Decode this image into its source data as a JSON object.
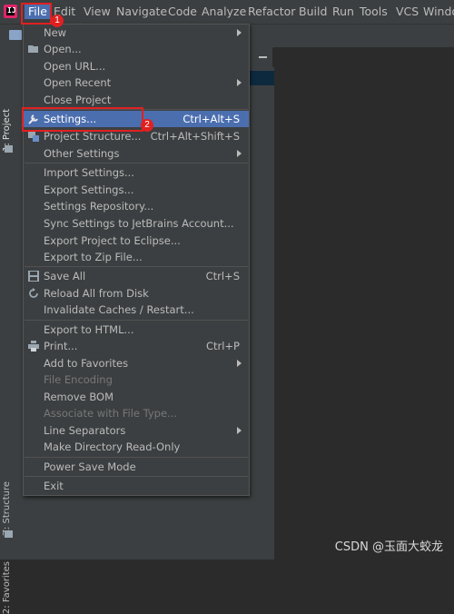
{
  "menubar": {
    "items": [
      "File",
      "Edit",
      "View",
      "Navigate",
      "Code",
      "Analyze",
      "Refactor",
      "Build",
      "Run",
      "Tools",
      "VCS",
      "Windo"
    ]
  },
  "tool_strip": {
    "project_tab": "1: Project",
    "structure_tab": "Z: Structure",
    "favorites_tab": "2: Favorites"
  },
  "file_menu": [
    {
      "label": "New",
      "submenu": true
    },
    {
      "label": "Open...",
      "icon": "folder-open-icon"
    },
    {
      "label": "Open URL..."
    },
    {
      "label": "Open Recent",
      "submenu": true
    },
    {
      "label": "Close Project"
    },
    {
      "label": "Settings...",
      "shortcut": "Ctrl+Alt+S",
      "icon": "wrench-icon",
      "selected": true
    },
    {
      "label": "Project Structure...",
      "shortcut": "Ctrl+Alt+Shift+S",
      "icon": "project-structure-icon"
    },
    {
      "label": "Other Settings",
      "submenu": true
    },
    {
      "label": "Import Settings..."
    },
    {
      "label": "Export Settings..."
    },
    {
      "label": "Settings Repository..."
    },
    {
      "label": "Sync Settings to JetBrains Account..."
    },
    {
      "label": "Export Project to Eclipse..."
    },
    {
      "label": "Export to Zip File..."
    },
    {
      "label": "Save All",
      "shortcut": "Ctrl+S",
      "icon": "save-icon"
    },
    {
      "label": "Reload All from Disk",
      "icon": "reload-icon"
    },
    {
      "label": "Invalidate Caches / Restart..."
    },
    {
      "label": "Export to HTML..."
    },
    {
      "label": "Print...",
      "shortcut": "Ctrl+P",
      "icon": "print-icon"
    },
    {
      "label": "Add to Favorites",
      "submenu": true
    },
    {
      "label": "File Encoding",
      "disabled": true
    },
    {
      "label": "Remove BOM"
    },
    {
      "label": "Associate with File Type...",
      "disabled": true
    },
    {
      "label": "Line Separators",
      "submenu": true
    },
    {
      "label": "Make Directory Read-Only"
    },
    {
      "label": "Power Save Mode"
    },
    {
      "label": "Exit"
    }
  ],
  "annotations": {
    "badge_1": "1",
    "badge_2": "2"
  },
  "watermark": "CSDN @玉面大蛟龙",
  "colors": {
    "selection": "#4b6eaf",
    "menu_bg": "#3c3f41",
    "annotation_red": "#e02020"
  }
}
